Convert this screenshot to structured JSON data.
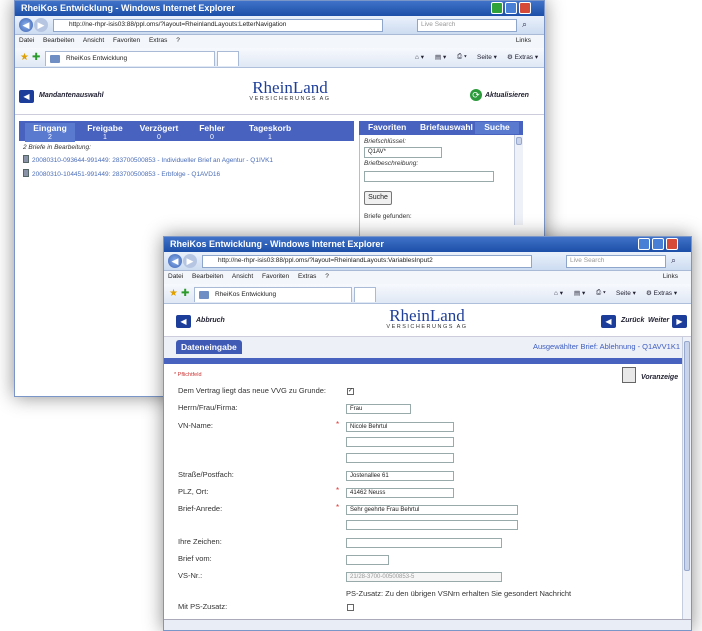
{
  "back_window": {
    "title": "RheiKos Entwicklung - Windows Internet Explorer",
    "url": "http://ne-rhpr-isis03:88/ppl.oms/?layout=RheinlandLayouts:LetterNavigation",
    "search_placeholder": "Live Search",
    "menu": [
      "Datei",
      "Bearbeiten",
      "Ansicht",
      "Favoriten",
      "Extras",
      "?"
    ],
    "links_label": "Links",
    "tab_label": "RheiKos Entwicklung",
    "tools": {
      "seite": "Seite",
      "extras": "Extras"
    },
    "logo": {
      "name": "RheinLand",
      "sub": "VERSICHERUNGS AG"
    },
    "mandant_label": "Mandantenauswahl",
    "refresh_label": "Aktualisieren",
    "tabs": [
      {
        "label": "Eingang",
        "count": "2"
      },
      {
        "label": "Freigabe",
        "count": "1"
      },
      {
        "label": "Verzögert",
        "count": "0"
      },
      {
        "label": "Fehler",
        "count": "0"
      },
      {
        "label": "Tageskorb",
        "count": "1"
      }
    ],
    "right_tabs": [
      "Favoriten",
      "Briefauswahl",
      "Suche"
    ],
    "in_progress_text": "2 Briefe in Bearbeitung:",
    "letters": [
      "20080310-093644-991449: 283700500853 - Individueller Brief an Agentur - Q1IVK1",
      "20080310-104451-991449: 283700500853 - Erbfolge - Q1AVD16"
    ],
    "search": {
      "key_label": "Briefschlüssel:",
      "key_value": "Q1AV*",
      "desc_label": "Briefbeschreibung:",
      "desc_value": "",
      "button": "Suche",
      "found_label": "Briefe gefunden:"
    }
  },
  "front_window": {
    "title": "RheiKos Entwicklung - Windows Internet Explorer",
    "url": "http://ne-rhpr-isis03:88/ppl.oms/?layout=RheinlandLayouts:VariablesInput2",
    "search_placeholder": "Live Search",
    "menu": [
      "Datei",
      "Bearbeiten",
      "Ansicht",
      "Favoriten",
      "Extras",
      "?"
    ],
    "links_label": "Links",
    "tab_label": "RheiKos Entwicklung",
    "tools": {
      "seite": "Seite",
      "extras": "Extras"
    },
    "logo": {
      "name": "RheinLand",
      "sub": "VERSICHERUNGS AG"
    },
    "abbruch": "Abbruch",
    "zurueck": "Zurück",
    "weiter": "Weiter",
    "section_tab": "Dateneingabe",
    "selected_letter": "Ausgewählter Brief: Ablehnung - Q1AVV1K1",
    "required_hint": "* Pflichtfeld",
    "preview": "Voranzeige",
    "form": {
      "vvg_label": "Dem Vertrag liegt das neue VVG zu Grunde:",
      "herrn_label": "Herrn/Frau/Firma:",
      "herrn_value": "Frau",
      "vn_label": "VN-Name:",
      "vn_value": "Nicole Behrtul",
      "strasse_label": "Straße/Postfach:",
      "strasse_value": "Jostenallee 61",
      "plz_label": "PLZ, Ort:",
      "plz_value": "41462 Neuss",
      "anrede_label": "Brief-Anrede:",
      "anrede_value": "Sehr geehrte Frau Behrtul",
      "zeichen_label": "Ihre Zeichen:",
      "brief_vom_label": "Brief vom:",
      "vs_label": "VS-Nr.:",
      "vs_value": "21/28-3700-00500853-5",
      "ps_text": "PS-Zusatz: Zu den übrigen VSNrn erhalten Sie gesondert Nachricht",
      "mit_ps_label": "Mit PS-Zusatz:"
    }
  },
  "colors": {
    "brand_blue": "#1c3d99",
    "tabbar": "#4862c0",
    "required": "#e03030"
  }
}
